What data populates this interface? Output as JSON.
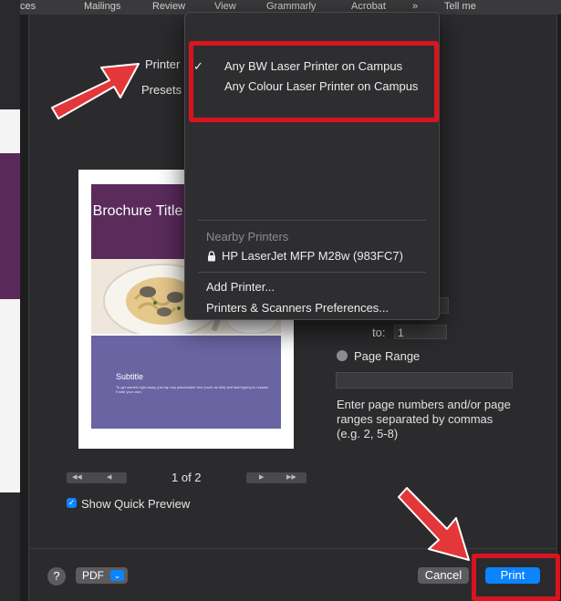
{
  "background_menu": [
    "erences",
    "Mailings",
    "Review",
    "View",
    "Grammarly",
    "Acrobat",
    "»",
    "Tell me"
  ],
  "print_dialog": {
    "printer_label": "Printer",
    "presets_label": "Presets",
    "preview": {
      "brochure_title": "Brochure Title",
      "subtitle": "Subtitle",
      "body_text": "To get started right away, just tap any placeholder text (such as this) and start typing to replace it with your own."
    },
    "page_nav": {
      "count": "1 of 2"
    },
    "show_quick_preview": {
      "label": "Show Quick Preview",
      "checked": true
    },
    "pages": {
      "to_label": "to:",
      "to_value": "1",
      "page_range_label": "Page Range",
      "hint": "Enter page numbers and/or page ranges separated by commas (e.g. 2, 5-8)"
    },
    "bottom": {
      "help": "?",
      "pdf": "PDF",
      "cancel": "Cancel",
      "print": "Print"
    }
  },
  "printer_menu": {
    "items": [
      {
        "label": "Any BW Laser Printer on Campus",
        "checked": true
      },
      {
        "label": "Any Colour Laser Printer on Campus",
        "checked": false
      }
    ],
    "nearby_header": "Nearby Printers",
    "nearby_printer": "HP LaserJet MFP M28w (983FC7)",
    "add_printer": "Add Printer...",
    "preferences": "Printers & Scanners Preferences..."
  },
  "colors": {
    "highlight": "#d7151f",
    "accent": "#0a84ff",
    "hero_purple": "#5a2b5b",
    "subtitle_band": "#6a64a2"
  }
}
